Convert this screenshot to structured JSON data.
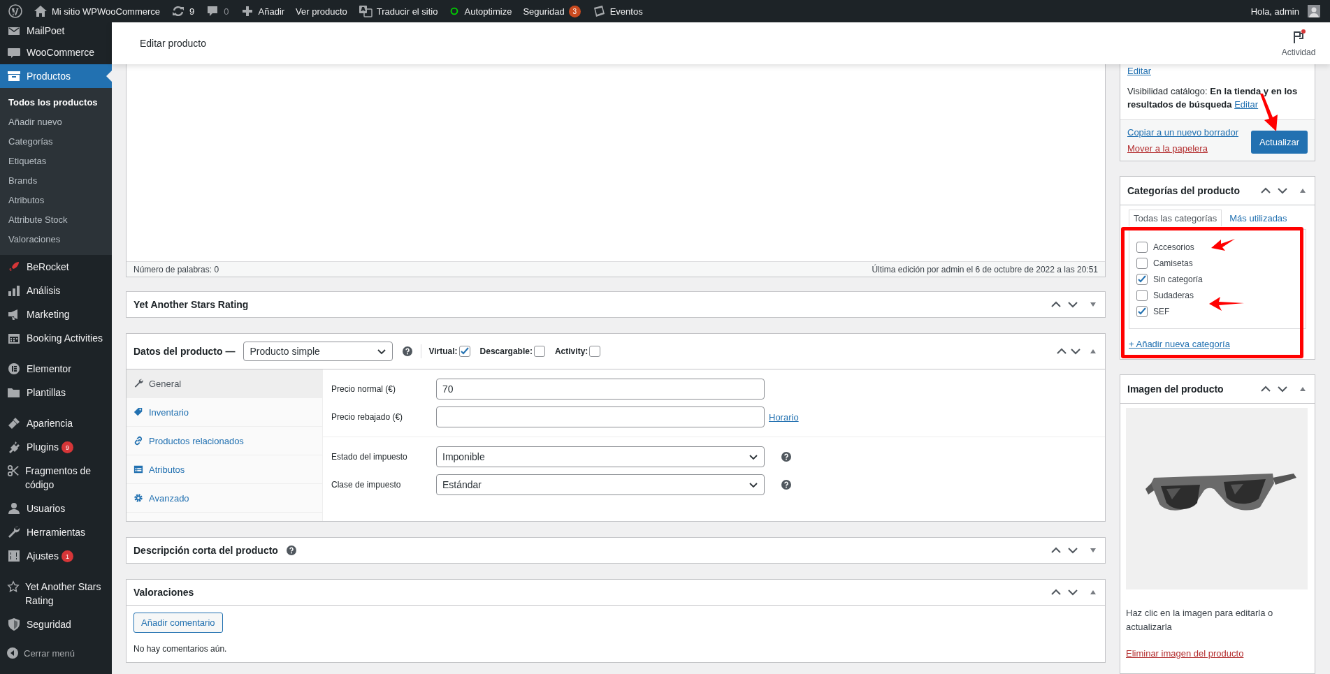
{
  "admin_bar": {
    "items": [
      {
        "kind": "logo"
      },
      {
        "kind": "site",
        "label": "Mi sitio WPWooCommerce"
      },
      {
        "kind": "updates",
        "label": "9"
      },
      {
        "kind": "comments",
        "label": "0"
      },
      {
        "kind": "new",
        "label": "Añadir"
      },
      {
        "kind": "plain",
        "label": "Ver producto"
      },
      {
        "kind": "translate",
        "label": "Traducir el sitio"
      },
      {
        "kind": "status",
        "label": "Autoptimize"
      },
      {
        "kind": "plain",
        "label": "Seguridad",
        "badge": "3"
      },
      {
        "kind": "events",
        "label": "Eventos"
      }
    ],
    "greeting": "Hola, admin"
  },
  "sidebar": {
    "groups": [
      [
        {
          "label": "MailPoet",
          "selected": false
        }
      ],
      [
        {
          "label": "WooCommerce",
          "selected": false
        },
        {
          "label": "Productos",
          "selected": true,
          "children": [
            {
              "label": "Todos los productos",
              "selected": true
            },
            {
              "label": "Añadir nuevo",
              "selected": false
            },
            {
              "label": "Categorías",
              "selected": false
            },
            {
              "label": "Etiquetas",
              "selected": false
            },
            {
              "label": "Brands",
              "selected": false
            },
            {
              "label": "Atributos",
              "selected": false
            },
            {
              "label": "Attribute Stock",
              "selected": false
            },
            {
              "label": "Valoraciones",
              "selected": false
            }
          ]
        },
        {
          "label": "BeRocket",
          "selected": false
        },
        {
          "label": "Análisis",
          "selected": false
        },
        {
          "label": "Marketing",
          "selected": false
        },
        {
          "label": "Booking Activities",
          "selected": false
        }
      ],
      [
        {
          "label": "Elementor",
          "selected": false
        },
        {
          "label": "Plantillas",
          "selected": false
        }
      ],
      [
        {
          "label": "Apariencia",
          "selected": false
        },
        {
          "label": "Plugins",
          "selected": false,
          "badge": "9"
        },
        {
          "label": "Fragmentos de código",
          "selected": false
        },
        {
          "label": "Usuarios",
          "selected": false
        },
        {
          "label": "Herramientas",
          "selected": false
        },
        {
          "label": "Ajustes",
          "selected": false,
          "badge": "1"
        }
      ],
      [
        {
          "label": "Yet Another Stars Rating",
          "selected": false
        },
        {
          "label": "Seguridad",
          "selected": false
        }
      ]
    ],
    "collapse": "Cerrar menú"
  },
  "header": {
    "title": "Editar producto",
    "activity": "Actividad"
  },
  "editor": {
    "word_count": "Número de palabras: 0",
    "last_edit": "Última edición por admin el 6 de octubre de 2022 a las 20:51"
  },
  "stars_rating_box": {
    "title": "Yet Another Stars Rating",
    "expanded": false
  },
  "product_data": {
    "title": "Datos del producto —",
    "type_select": "Producto simple",
    "expanded": true,
    "options": [
      {
        "label": "Virtual:",
        "checked": true
      },
      {
        "label": "Descargable:",
        "checked": false
      },
      {
        "label": "Activity:",
        "checked": false
      }
    ],
    "tabs": [
      {
        "label": "General",
        "selected": true
      },
      {
        "label": "Inventario",
        "selected": false
      },
      {
        "label": "Productos relacionados",
        "selected": false
      },
      {
        "label": "Atributos",
        "selected": false
      },
      {
        "label": "Avanzado",
        "selected": false
      }
    ],
    "field_groups": [
      [
        {
          "kind": "text",
          "label": "Precio normal (€)",
          "value": "70"
        },
        {
          "kind": "text",
          "label": "Precio rebajado (€)",
          "link": "Horario"
        }
      ],
      [
        {
          "kind": "select",
          "label": "Estado del impuesto",
          "value": "Imponible"
        },
        {
          "kind": "select",
          "label": "Clase de impuesto",
          "value": "Estándar"
        }
      ]
    ]
  },
  "short_description": {
    "title": "Descripción corta del producto",
    "expanded": false
  },
  "reviews": {
    "title": "Valoraciones",
    "expanded": true,
    "button": "Añadir comentario",
    "empty_text": "No hay comentarios aún."
  },
  "publish": {
    "edit_link": "Editar",
    "visibility": "Visibilidad catálogo: **En la tienda y en los resultados de búsqueda**",
    "visibility_edit": "Editar",
    "copy_link": "Copiar a un nuevo borrador",
    "trash_link": "Mover a la papelera",
    "update_button": "Actualizar"
  },
  "categories": {
    "title": "Categorías del producto",
    "expanded": true,
    "tabs": [
      {
        "label": "Todas las categorías",
        "selected": true
      },
      {
        "label": "Más utilizadas",
        "selected": false
      }
    ],
    "items": [
      {
        "label": "Accesorios",
        "checked": false
      },
      {
        "label": "Camisetas",
        "checked": false
      },
      {
        "label": "Sin categoría",
        "checked": true
      },
      {
        "label": "Sudaderas",
        "checked": false
      },
      {
        "label": "SEF",
        "checked": true
      }
    ],
    "add_link": "+ Añadir nueva categoría"
  },
  "product_image": {
    "title": "Imagen del producto",
    "expanded": true,
    "hint": "Haz clic en la imagen para editarla o actualizarla",
    "remove_link": "Eliminar imagen del producto"
  }
}
